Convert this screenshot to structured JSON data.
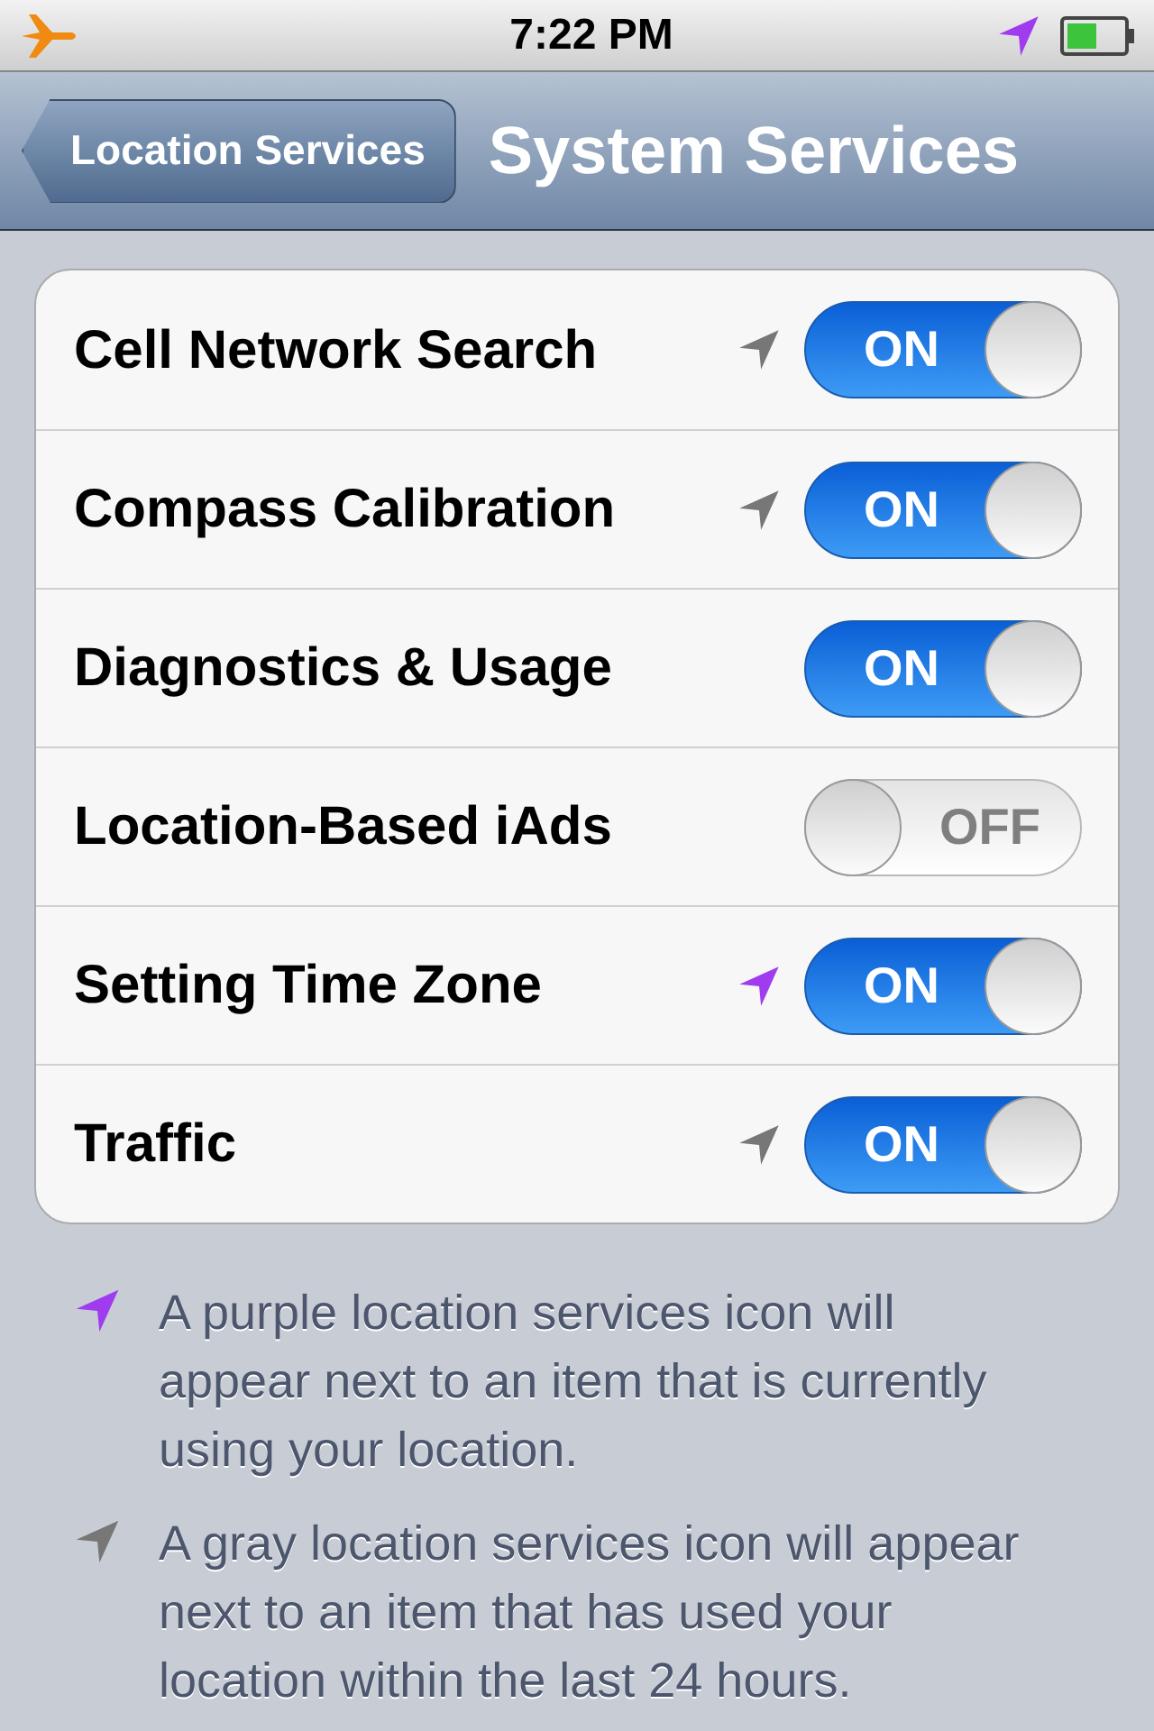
{
  "status_bar": {
    "time": "7:22 PM"
  },
  "nav": {
    "back": "Location Services",
    "title": "System Services"
  },
  "rows": [
    {
      "label": "Cell Network Search",
      "color": "#777777",
      "on": true,
      "toggle_label": "ON"
    },
    {
      "label": "Compass Calibration",
      "color": "#777777",
      "on": true,
      "toggle_label": "ON"
    },
    {
      "label": "Diagnostics & Usage",
      "on": true,
      "toggle_label": "ON"
    },
    {
      "label": "Location-Based iAds",
      "on": false,
      "toggle_label": "OFF"
    },
    {
      "label": "Setting Time Zone",
      "color": "#a03cf0",
      "on": true,
      "toggle_label": "ON"
    },
    {
      "label": "Traffic",
      "color": "#777777",
      "on": true,
      "toggle_label": "ON"
    }
  ],
  "notes": [
    {
      "color": "#a03cf0",
      "text": "A purple location services icon will appear next to an item that is currently using your location."
    },
    {
      "color": "#777777",
      "text": "A gray location services icon will appear next to an item that has used your location within the last 24 hours."
    }
  ]
}
